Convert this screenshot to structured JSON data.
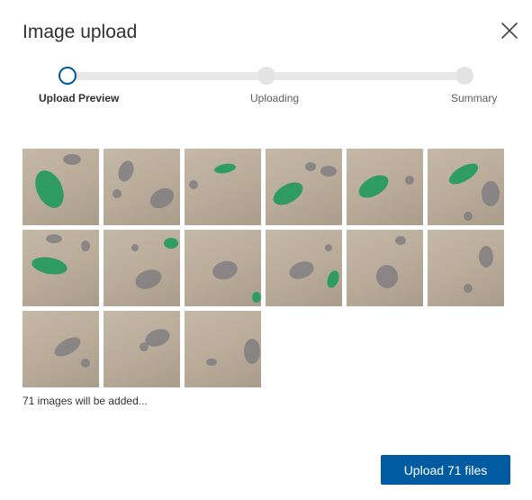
{
  "dialog": {
    "title": "Image upload",
    "close_icon": "close-icon"
  },
  "stepper": {
    "steps": [
      {
        "label": "Upload Preview",
        "state": "active"
      },
      {
        "label": "Uploading",
        "state": "pending"
      },
      {
        "label": "Summary",
        "state": "pending"
      }
    ]
  },
  "preview": {
    "thumbnails": [
      {
        "subject": "green-and-gray-figurines"
      },
      {
        "subject": "gray-figurines"
      },
      {
        "subject": "green-figurine"
      },
      {
        "subject": "green-and-gray-figurines"
      },
      {
        "subject": "green-figurine"
      },
      {
        "subject": "green-and-gray-figurines"
      },
      {
        "subject": "green-and-gray-figurines"
      },
      {
        "subject": "green-and-gray-figurines"
      },
      {
        "subject": "gray-figurine"
      },
      {
        "subject": "green-and-gray-figurines"
      },
      {
        "subject": "gray-figurine"
      },
      {
        "subject": "gray-figurines"
      },
      {
        "subject": "gray-figurines"
      },
      {
        "subject": "gray-figurines"
      },
      {
        "subject": "gray-figurines"
      }
    ],
    "count_text": "71 images will be added..."
  },
  "footer": {
    "upload_label": "Upload 71 files"
  },
  "colors": {
    "accent": "#005ba1",
    "step_active_border": "#005a9e",
    "track": "#e8e8e8",
    "figurine_green": "#1f9a5a",
    "figurine_gray": "#7d7c80"
  }
}
